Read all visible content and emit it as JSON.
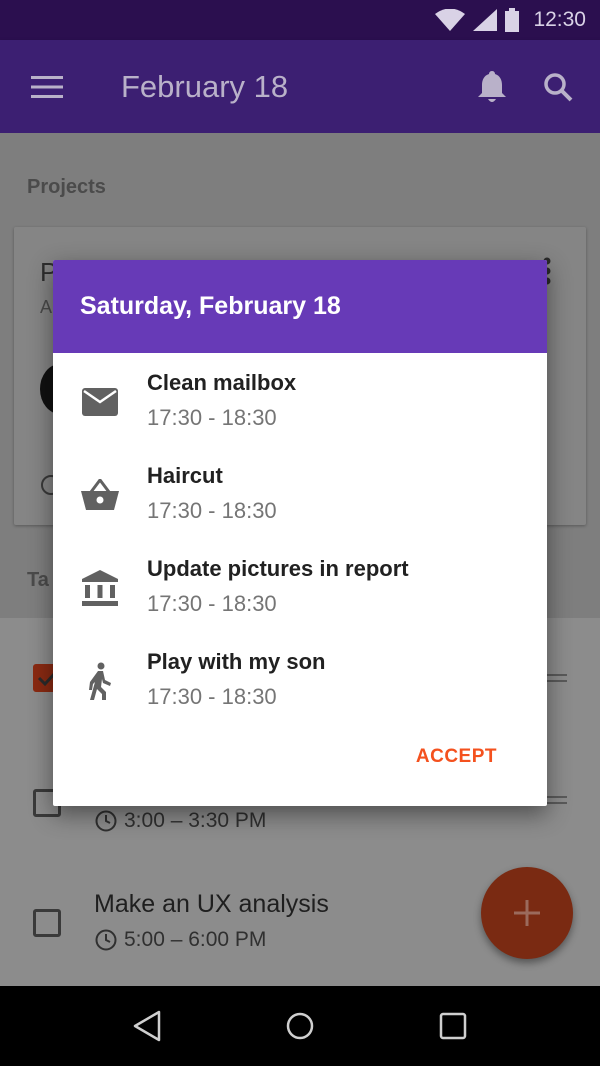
{
  "status_bar": {
    "time": "12:30"
  },
  "app_bar": {
    "title": "February 18"
  },
  "background": {
    "projects_label": "Projects",
    "tasks_label_fragment": "Ta",
    "card_title_fragment": "P",
    "card_subtitle_fragment": "A",
    "tasks": [
      {
        "title": "",
        "time": "",
        "checked": true
      },
      {
        "title": "",
        "time": "3:00 – 3:30 PM",
        "checked": false
      },
      {
        "title": "Make an UX analysis",
        "time": "5:00 – 6:00 PM",
        "checked": false
      }
    ]
  },
  "dialog": {
    "title": "Saturday, February 18",
    "events": [
      {
        "title": "Clean mailbox",
        "time": "17:30 - 18:30",
        "icon": "mail-icon"
      },
      {
        "title": "Haircut",
        "time": "17:30 - 18:30",
        "icon": "basket-icon"
      },
      {
        "title": "Update pictures in report",
        "time": "17:30 - 18:30",
        "icon": "bank-icon"
      },
      {
        "title": "Play with my son",
        "time": "17:30 - 18:30",
        "icon": "walk-icon"
      }
    ],
    "accept_label": "ACCEPT"
  },
  "colors": {
    "dialog_header": "#673ab7",
    "accent": "#f4511e",
    "app_bar": "#3c1f72"
  }
}
